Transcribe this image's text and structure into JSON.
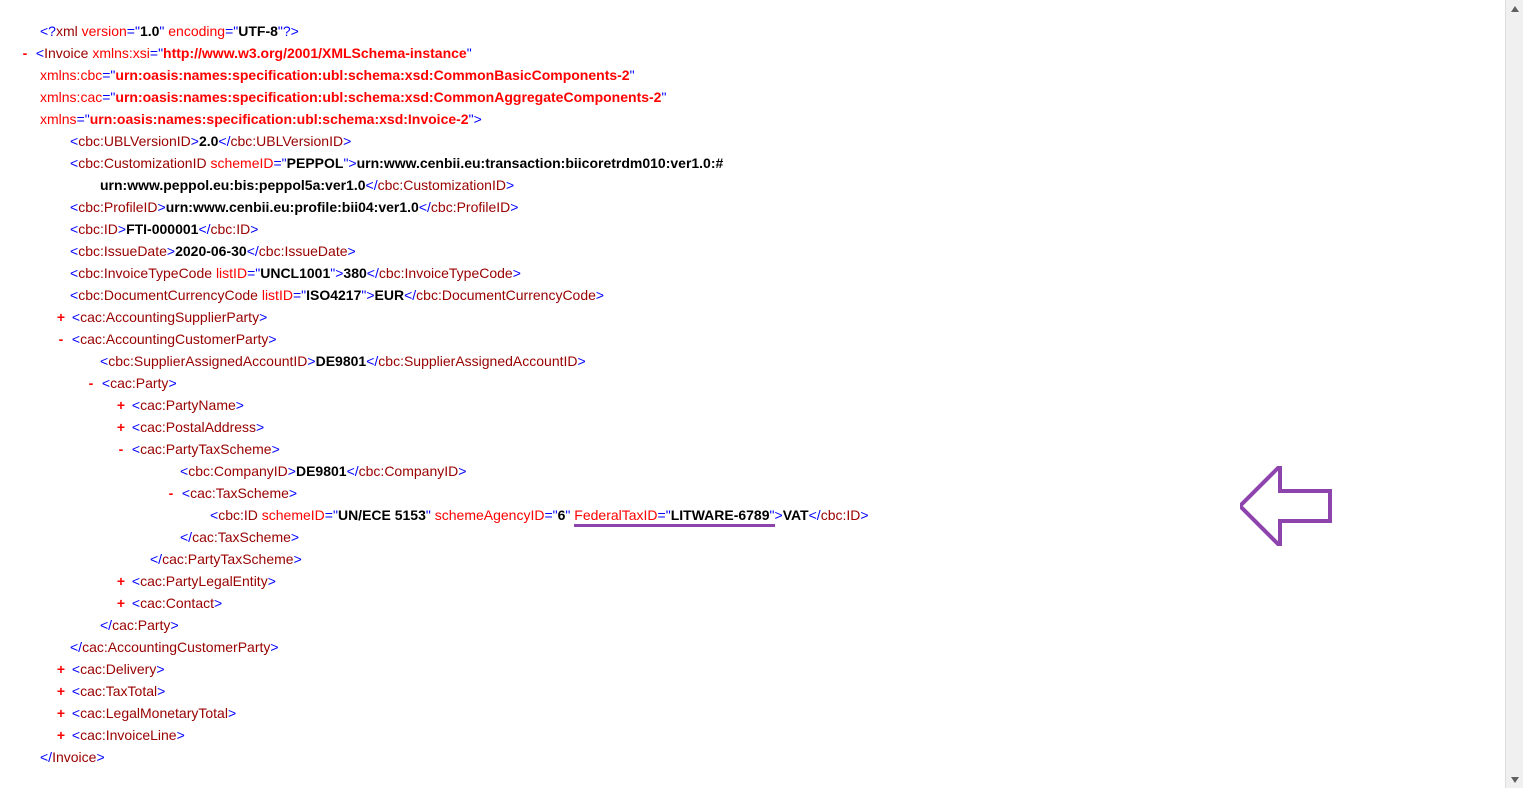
{
  "xml_decl": {
    "version": "1.0",
    "encoding": "UTF-8"
  },
  "root": {
    "tag": "Invoice",
    "xmlns_xsi_attr": "xmlns:xsi",
    "xmlns_xsi_val": "http://www.w3.org/2001/XMLSchema-instance",
    "xmlns_cbc_attr": "xmlns:cbc",
    "xmlns_cbc_val": "urn:oasis:names:specification:ubl:schema:xsd:CommonBasicComponents-2",
    "xmlns_cac_attr": "xmlns:cac",
    "xmlns_cac_val": "urn:oasis:names:specification:ubl:schema:xsd:CommonAggregateComponents-2",
    "xmlns_attr": "xmlns",
    "xmlns_val": "urn:oasis:names:specification:ubl:schema:xsd:Invoice-2",
    "close": "Invoice"
  },
  "ublversion": {
    "tag": "cbc:UBLVersionID",
    "val": "2.0"
  },
  "customization": {
    "tag": "cbc:CustomizationID",
    "attr": "schemeID",
    "attr_val": "PEPPOL",
    "val1": "urn:www.cenbii.eu:transaction:biicoretrdm010:ver1.0:#",
    "val2": "urn:www.peppol.eu:bis:peppol5a:ver1.0"
  },
  "profile": {
    "tag": "cbc:ProfileID",
    "val": "urn:www.cenbii.eu:profile:bii04:ver1.0"
  },
  "id": {
    "tag": "cbc:ID",
    "val": "FTI-000001"
  },
  "issuedate": {
    "tag": "cbc:IssueDate",
    "val": "2020-06-30"
  },
  "invtypecode": {
    "tag": "cbc:InvoiceTypeCode",
    "attr": "listID",
    "attr_val": "UNCL1001",
    "val": "380"
  },
  "currency": {
    "tag": "cbc:DocumentCurrencyCode",
    "attr": "listID",
    "attr_val": "ISO4217",
    "val": "EUR"
  },
  "supplier": {
    "tag": "cac:AccountingSupplierParty"
  },
  "customer": {
    "tag": "cac:AccountingCustomerParty"
  },
  "supacct": {
    "tag": "cbc:SupplierAssignedAccountID",
    "val": "DE9801"
  },
  "party": {
    "tag": "cac:Party"
  },
  "partyname": {
    "tag": "cac:PartyName"
  },
  "postaladdr": {
    "tag": "cac:PostalAddress"
  },
  "partytax": {
    "tag": "cac:PartyTaxScheme"
  },
  "companyid": {
    "tag": "cbc:CompanyID",
    "val": "DE9801"
  },
  "taxscheme": {
    "tag": "cac:TaxScheme"
  },
  "taxid": {
    "tag": "cbc:ID",
    "a1": "schemeID",
    "v1": "UN/ECE 5153",
    "a2": "schemeAgencyID",
    "v2": "6",
    "a3": "FederalTaxID",
    "v3": "LITWARE-6789",
    "val": "VAT"
  },
  "legalentity": {
    "tag": "cac:PartyLegalEntity"
  },
  "contact": {
    "tag": "cac:Contact"
  },
  "delivery": {
    "tag": "cac:Delivery"
  },
  "taxtotal": {
    "tag": "cac:TaxTotal"
  },
  "legalmonetary": {
    "tag": "cac:LegalMonetaryTotal"
  },
  "invoiceline": {
    "tag": "cac:InvoiceLine"
  },
  "toggles": {
    "plus": "+",
    "minus": "-"
  }
}
